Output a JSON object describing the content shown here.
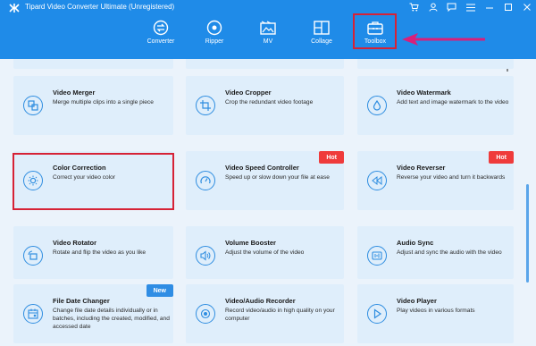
{
  "app": {
    "title": "Tipard Video Converter Ultimate (Unregistered)"
  },
  "window_controls": [
    {
      "name": "cart-icon"
    },
    {
      "name": "account-icon"
    },
    {
      "name": "chat-icon"
    },
    {
      "name": "menu-icon"
    },
    {
      "name": "minimize-icon"
    },
    {
      "name": "maximize-icon"
    },
    {
      "name": "close-icon"
    }
  ],
  "nav": {
    "converter": "Converter",
    "ripper": "Ripper",
    "mv": "MV",
    "collage": "Collage",
    "toolbox": "Toolbox",
    "active": "Toolbox"
  },
  "colors": {
    "titlebar": "#1f8be8",
    "accent": "#2e8de0",
    "card_bg": "#dfeefb",
    "hot_badge": "#ef3b3b",
    "new_badge": "#2f8de4",
    "highlight": "#d62236",
    "annotation_arrow": "#d81f7a"
  },
  "tools": [
    {
      "title": "Video Merger",
      "desc": "Merge multiple clips into a single piece",
      "icon": "merge-icon"
    },
    {
      "title": "Video Cropper",
      "desc": "Crop the redundant video footage",
      "icon": "crop-icon"
    },
    {
      "title": "Video Watermark",
      "desc": "Add text and image watermark to the video",
      "icon": "watermark-icon"
    },
    {
      "title": "Color Correction",
      "desc": "Correct your video color",
      "icon": "color-correction-icon"
    },
    {
      "title": "Video Speed Controller",
      "desc": "Speed up or slow down your file at ease",
      "icon": "speed-icon",
      "badge": "Hot"
    },
    {
      "title": "Video Reverser",
      "desc": "Reverse your video and turn it backwards",
      "icon": "reverse-icon",
      "badge": "Hot"
    },
    {
      "title": "Video Rotator",
      "desc": "Rotate and flip the video as you like",
      "icon": "rotate-icon"
    },
    {
      "title": "Volume Booster",
      "desc": "Adjust the volume of the video",
      "icon": "volume-icon"
    },
    {
      "title": "Audio Sync",
      "desc": "Adjust and sync the audio with the video",
      "icon": "audio-sync-icon"
    },
    {
      "title": "File Date Changer",
      "desc": "Change file date details individually or in batches, including the created, modified, and accessed date",
      "icon": "calendar-icon",
      "badge": "New"
    },
    {
      "title": "Video/Audio Recorder",
      "desc": "Record video/audio in high quality on your computer",
      "icon": "record-icon"
    },
    {
      "title": "Video Player",
      "desc": "Play videos in various formats",
      "icon": "play-icon"
    }
  ]
}
